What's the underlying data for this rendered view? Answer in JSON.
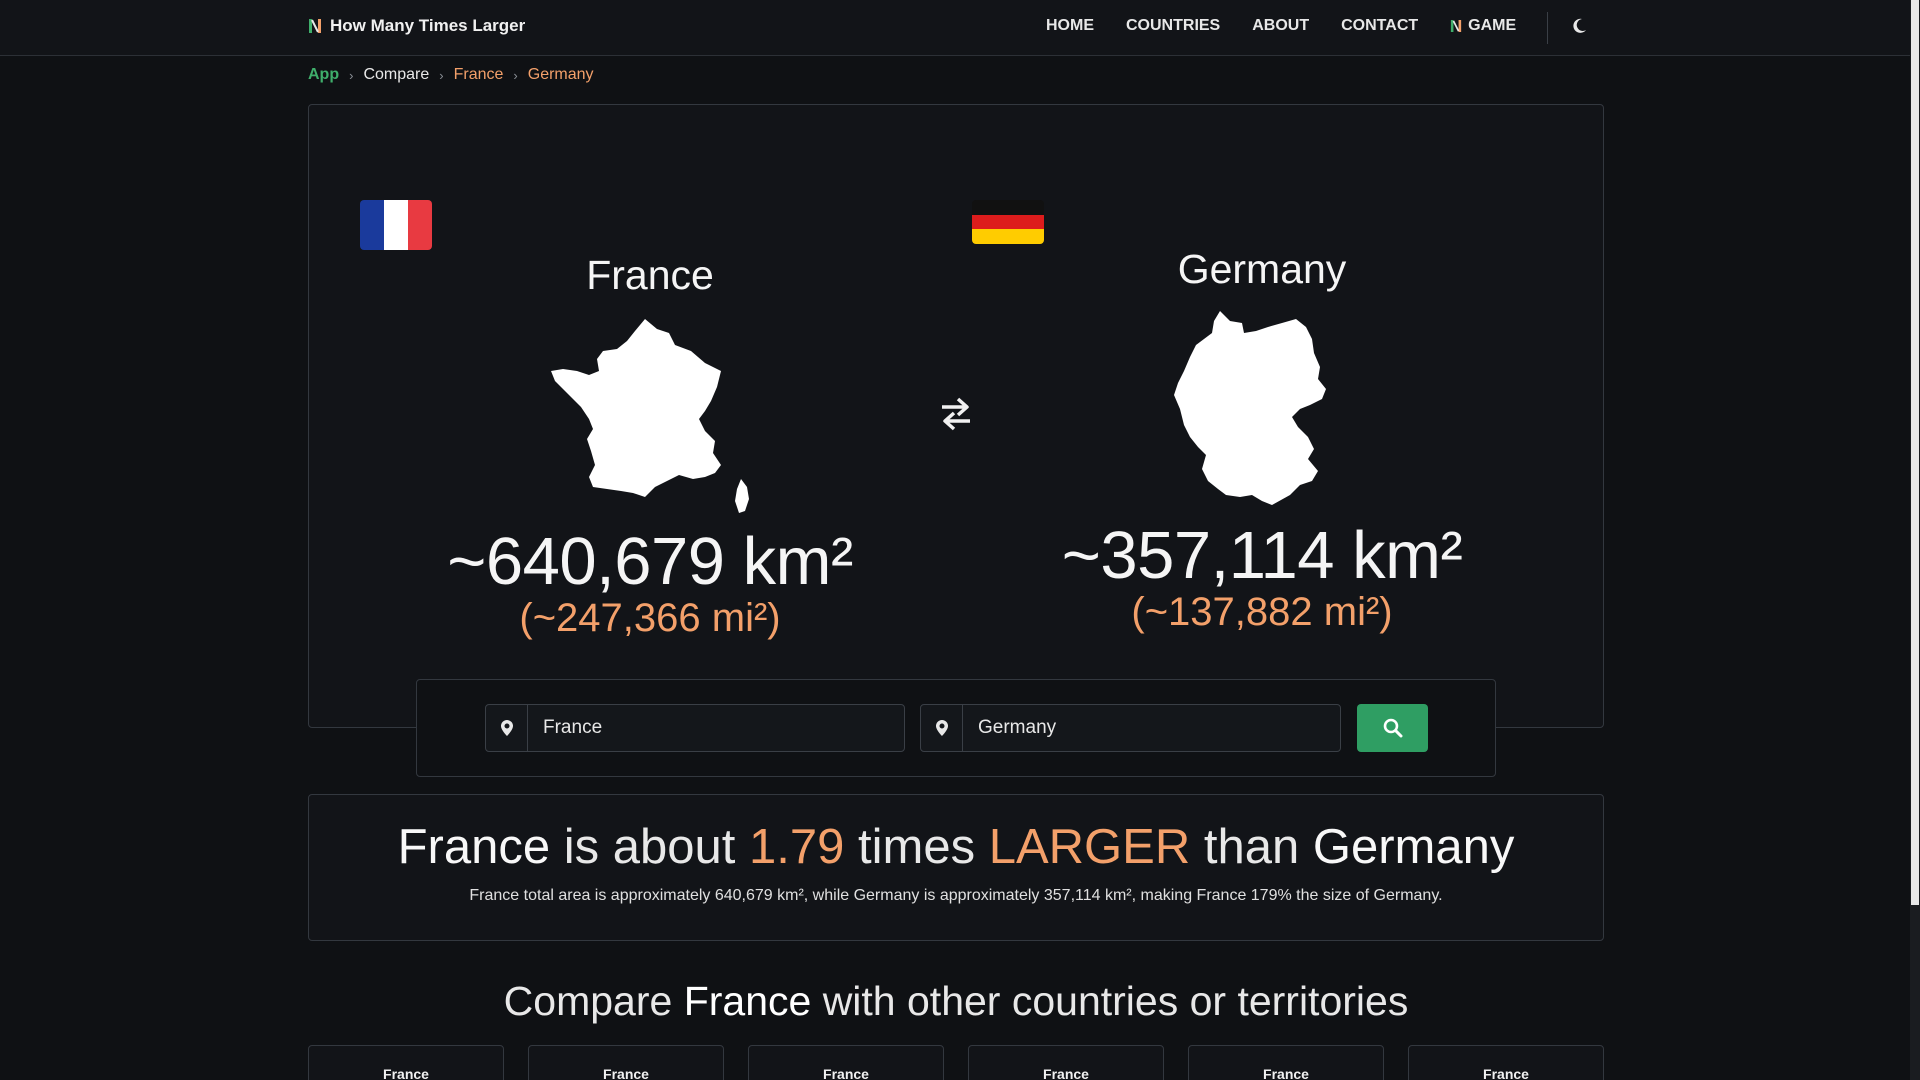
{
  "navbar": {
    "brand": "How Many Times Larger",
    "links": [
      "HOME",
      "COUNTRIES",
      "ABOUT",
      "CONTACT"
    ],
    "game_label": "GAME",
    "theme_icon": "moon-icon"
  },
  "breadcrumb": {
    "app": "App",
    "compare": "Compare",
    "country1": "France",
    "country2": "Germany"
  },
  "countries": {
    "left": {
      "name": "France",
      "area_km": "~640,679 km²",
      "area_mi": "(~247,366 mi²)"
    },
    "right": {
      "name": "Germany",
      "area_km": "~357,114 km²",
      "area_mi": "(~137,882 mi²)"
    }
  },
  "search": {
    "field1_value": "France",
    "field2_value": "Germany"
  },
  "result": {
    "country1": "France",
    "is_about": "is about",
    "ratio": "1.79",
    "times": "times",
    "comparison": "LARGER",
    "than": "than",
    "country2": "Germany",
    "description": "France total area is approximately 640,679 km², while Germany is approximately 357,114 km², making France 179% the size of Germany."
  },
  "compare_section": {
    "prefix": "Compare",
    "country": "France",
    "suffix": "with other countries or territories",
    "cards": [
      "France",
      "France",
      "France",
      "France",
      "France",
      "France"
    ]
  },
  "colors": {
    "accent_orange": "#f3a06a",
    "accent_green": "#2f9e63",
    "background": "#0f1114"
  }
}
